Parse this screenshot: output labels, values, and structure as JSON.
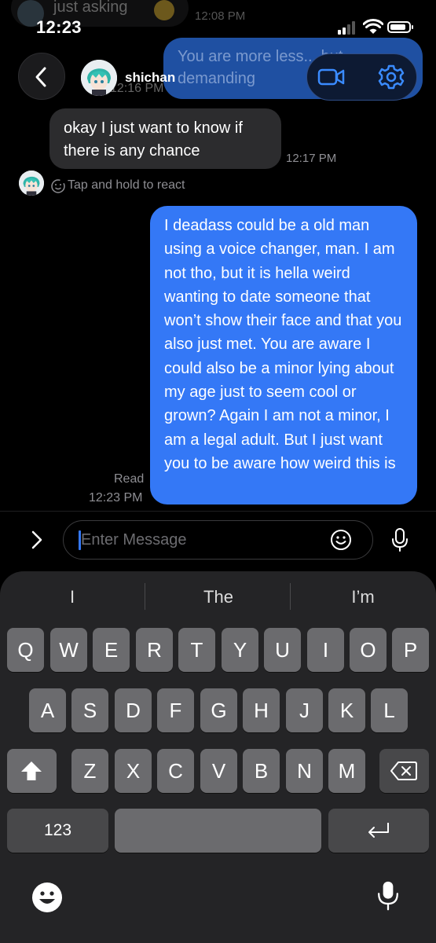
{
  "status_bar": {
    "time": "12:23"
  },
  "background_history": {
    "incoming_text": "just asking",
    "incoming_time": "12:08 PM",
    "outgoing_text": "You are more less... but demanding",
    "outgoing_time": "12:16 PM"
  },
  "header": {
    "contact_name": "shichan"
  },
  "messages": [
    {
      "direction": "incoming",
      "text": "okay I just want to know if there is any chance",
      "time": "12:17 PM"
    },
    {
      "direction": "outgoing",
      "text": "I deadass could be a old man using a voice changer, man. I am not tho, but it is hella weird wanting to date someone that won’t show their face and that you also just met. You are aware I could also be a minor lying about my age just to seem cool or grown? Again I am not a minor, I am a legal adult. But I just want you to be aware how weird this is",
      "status": "Read",
      "time": "12:23 PM"
    }
  ],
  "react_hint": "Tap and hold to react",
  "composer": {
    "placeholder": "Enter Message",
    "value": ""
  },
  "keyboard": {
    "suggestions": [
      "I",
      "The",
      "I’m"
    ],
    "row1": [
      "Q",
      "W",
      "E",
      "R",
      "T",
      "Y",
      "U",
      "I",
      "O",
      "P"
    ],
    "row2": [
      "A",
      "S",
      "D",
      "F",
      "G",
      "H",
      "J",
      "K",
      "L"
    ],
    "row3": [
      "Z",
      "X",
      "C",
      "V",
      "B",
      "N",
      "M"
    ],
    "numbers_label": "123"
  },
  "colors": {
    "outgoing_bubble": "#3478f6",
    "incoming_bubble": "#2c2c2e",
    "background": "#000000",
    "keyboard_bg": "#242426",
    "key_bg": "#6b6b6e"
  },
  "icons": [
    "back-chevron-icon",
    "video-call-icon",
    "settings-gear-icon",
    "react-smiley-icon",
    "expand-chevron-icon",
    "emoji-icon",
    "microphone-icon",
    "shift-icon",
    "backspace-icon",
    "return-icon",
    "emoji-keyboard-icon",
    "dictation-microphone-icon"
  ]
}
